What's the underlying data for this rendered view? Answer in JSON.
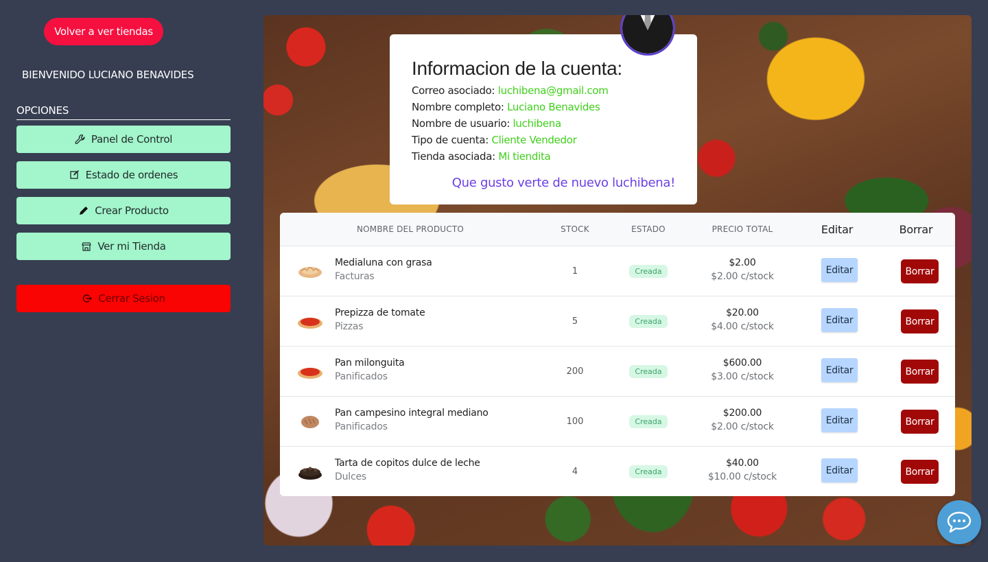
{
  "sidebar": {
    "back_label": "Volver a ver tiendas",
    "welcome": "BIENVENIDO LUCIANO BENAVIDES",
    "options_title": "OPCIONES",
    "buttons": [
      {
        "label": "Panel de Control",
        "icon": "wrench-icon"
      },
      {
        "label": "Estado de ordenes",
        "icon": "edit-icon"
      },
      {
        "label": "Crear Producto",
        "icon": "pencil-icon"
      },
      {
        "label": "Ver mi Tienda",
        "icon": "store-icon"
      }
    ],
    "logout_label": "Cerrar Sesion",
    "logout_icon": "logout-icon"
  },
  "account": {
    "title": "Informacion de la cuenta:",
    "email_label": "Correo asociado:",
    "email": "luchibena@gmail.com",
    "fullname_label": "Nombre completo:",
    "fullname": "Luciano Benavides",
    "username_label": "Nombre de usuario:",
    "username": "luchibena",
    "type_label": "Tipo de cuenta:",
    "type": "Cliente Vendedor",
    "store_label": "Tienda asociada:",
    "store": "Mi tiendita",
    "greeting": "Que gusto verte de nuevo luchibena!"
  },
  "table": {
    "headers": {
      "product": "NOMBRE DEL PRODUCTO",
      "stock": "STOCK",
      "status": "ESTADO",
      "price": "PRECIO TOTAL",
      "edit": "Editar",
      "delete": "Borrar"
    },
    "rows": [
      {
        "name": "Medialuna con grasa",
        "category": "Facturas",
        "stock": "1",
        "status": "Creada",
        "total": "$2.00",
        "unit": "$2.00 c/stock",
        "edit": "Editar",
        "delete": "Borrar",
        "thumb": "croissant"
      },
      {
        "name": "Prepizza de tomate",
        "category": "Pizzas",
        "stock": "5",
        "status": "Creada",
        "total": "$20.00",
        "unit": "$4.00 c/stock",
        "edit": "Editar",
        "delete": "Borrar",
        "thumb": "pizza"
      },
      {
        "name": "Pan milonguita",
        "category": "Panificados",
        "stock": "200",
        "status": "Creada",
        "total": "$600.00",
        "unit": "$3.00 c/stock",
        "edit": "Editar",
        "delete": "Borrar",
        "thumb": "pizza"
      },
      {
        "name": "Pan campesino integral mediano",
        "category": "Panificados",
        "stock": "100",
        "status": "Creada",
        "total": "$200.00",
        "unit": "$2.00 c/stock",
        "edit": "Editar",
        "delete": "Borrar",
        "thumb": "bread"
      },
      {
        "name": "Tarta de copitos dulce de leche",
        "category": "Dulces",
        "stock": "4",
        "status": "Creada",
        "total": "$40.00",
        "unit": "$10.00 c/stock",
        "edit": "Editar",
        "delete": "Borrar",
        "thumb": "cake"
      }
    ]
  },
  "colors": {
    "background": "#373e51",
    "accent_red": "#f5103f",
    "mint": "#a3f5cb",
    "logout": "#fa0303",
    "value_green": "#3fcf1a",
    "greeting_purple": "#6b3fe2",
    "delete_red": "#a10808",
    "edit_blue": "#b6d6ff",
    "chat_blue": "#4d9fd6"
  }
}
